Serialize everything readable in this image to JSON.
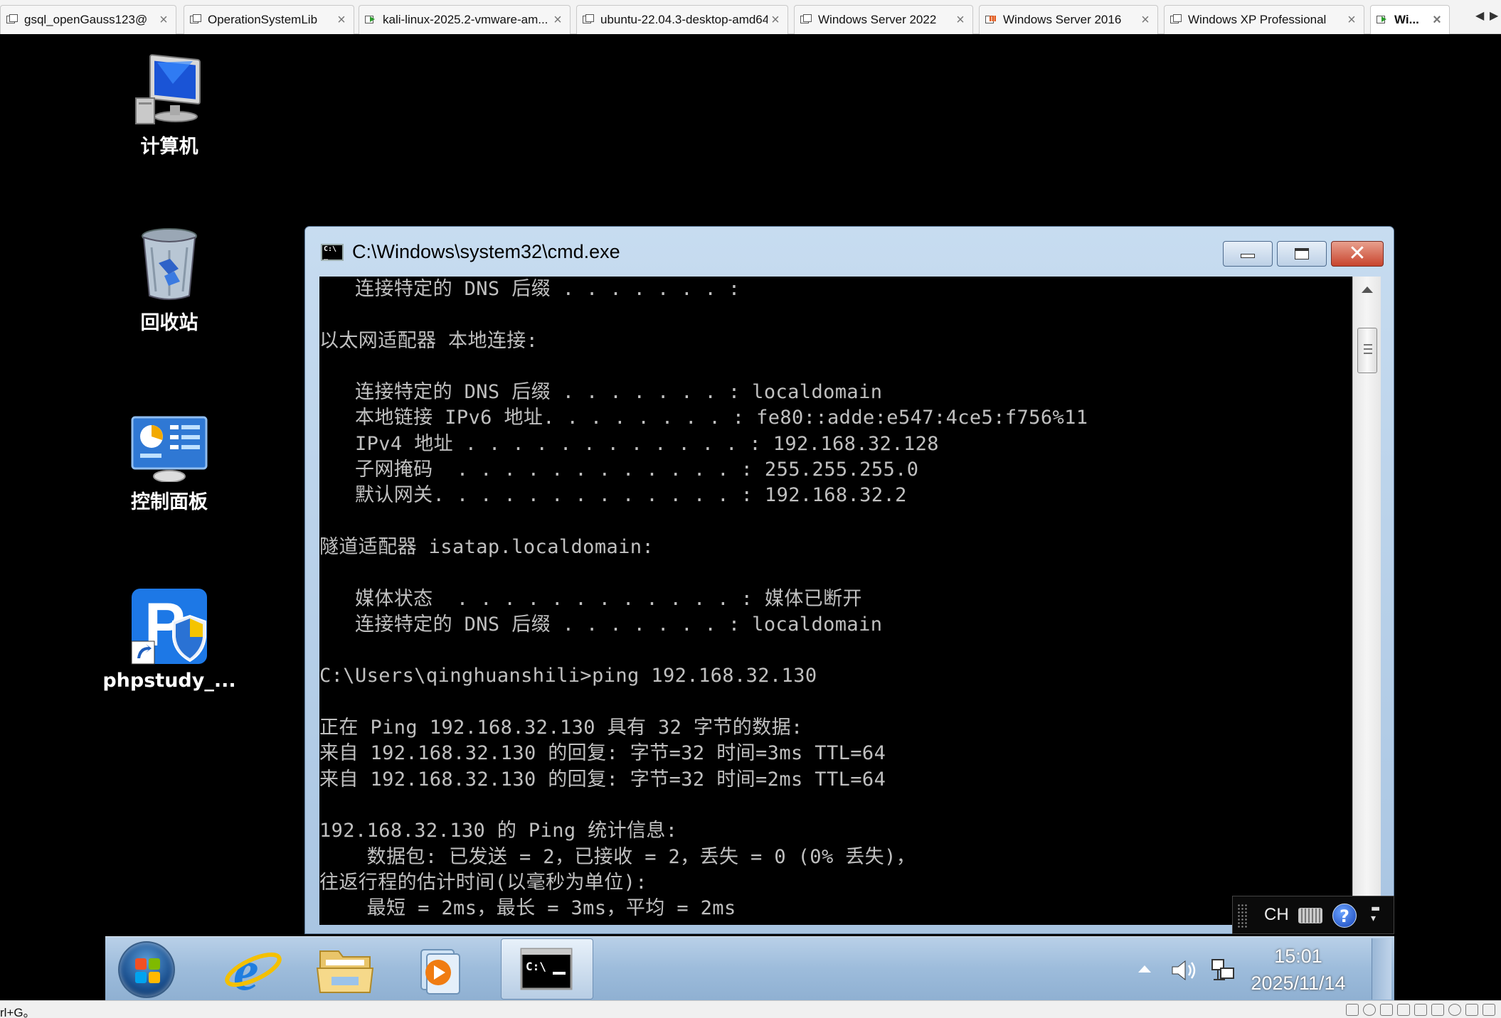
{
  "vm_tabs": [
    {
      "label": "gsql_openGauss123@",
      "icon": "vm-icon"
    },
    {
      "label": "OperationSystemLib",
      "icon": "vm-icon"
    },
    {
      "label": "kali-linux-2025.2-vmware-am...",
      "icon": "vm-running-icon"
    },
    {
      "label": "ubuntu-22.04.3-desktop-amd64",
      "icon": "vm-icon"
    },
    {
      "label": "Windows Server 2022",
      "icon": "vm-icon"
    },
    {
      "label": "Windows Server 2016",
      "icon": "vm-suspended-icon"
    },
    {
      "label": "Windows XP Professional",
      "icon": "vm-icon"
    },
    {
      "label": "Wi...",
      "icon": "vm-running-icon",
      "active": true
    }
  ],
  "desktop_icons": [
    {
      "label": "计算机",
      "icon": "computer-icon"
    },
    {
      "label": "回收站",
      "icon": "recycle-bin-icon"
    },
    {
      "label": "控制面板",
      "icon": "control-panel-icon"
    },
    {
      "label": "phpstudy_...",
      "icon": "phpstudy-shortcut-icon"
    }
  ],
  "cmd_window": {
    "title": "C:\\Windows\\system32\\cmd.exe",
    "console_lines": [
      "   连接特定的 DNS 后缀 . . . . . . . :",
      "",
      "以太网适配器 本地连接:",
      "",
      "   连接特定的 DNS 后缀 . . . . . . . : localdomain",
      "   本地链接 IPv6 地址. . . . . . . . : fe80::adde:e547:4ce5:f756%11",
      "   IPv4 地址 . . . . . . . . . . . . : 192.168.32.128",
      "   子网掩码  . . . . . . . . . . . . : 255.255.255.0",
      "   默认网关. . . . . . . . . . . . . : 192.168.32.2",
      "",
      "隧道适配器 isatap.localdomain:",
      "",
      "   媒体状态  . . . . . . . . . . . . : 媒体已断开",
      "   连接特定的 DNS 后缀 . . . . . . . : localdomain",
      "",
      "C:\\Users\\qinghuanshili>ping 192.168.32.130",
      "",
      "正在 Ping 192.168.32.130 具有 32 字节的数据:",
      "来自 192.168.32.130 的回复: 字节=32 时间=3ms TTL=64",
      "来自 192.168.32.130 的回复: 字节=32 时间=2ms TTL=64",
      "",
      "192.168.32.130 的 Ping 统计信息:",
      "    数据包: 已发送 = 2，已接收 = 2，丢失 = 0 (0% 丢失)，",
      "往返行程的估计时间(以毫秒为单位):",
      "    最短 = 2ms，最长 = 3ms，平均 = 2ms"
    ]
  },
  "language_bar": {
    "lang": "CH",
    "help": "?"
  },
  "taskbar": {
    "items": [
      "internet-explorer-icon",
      "file-explorer-icon",
      "media-player-icon",
      "cmd-icon"
    ],
    "clock_time": "15:01",
    "clock_date": "2025/11/14"
  },
  "status_bar": {
    "hint": "rl+G。"
  },
  "colors": {
    "console_text": "#c0c0c0",
    "console_bg": "#000000",
    "desktop_bg": "#000000",
    "taskbar": "#9dbcdb"
  }
}
